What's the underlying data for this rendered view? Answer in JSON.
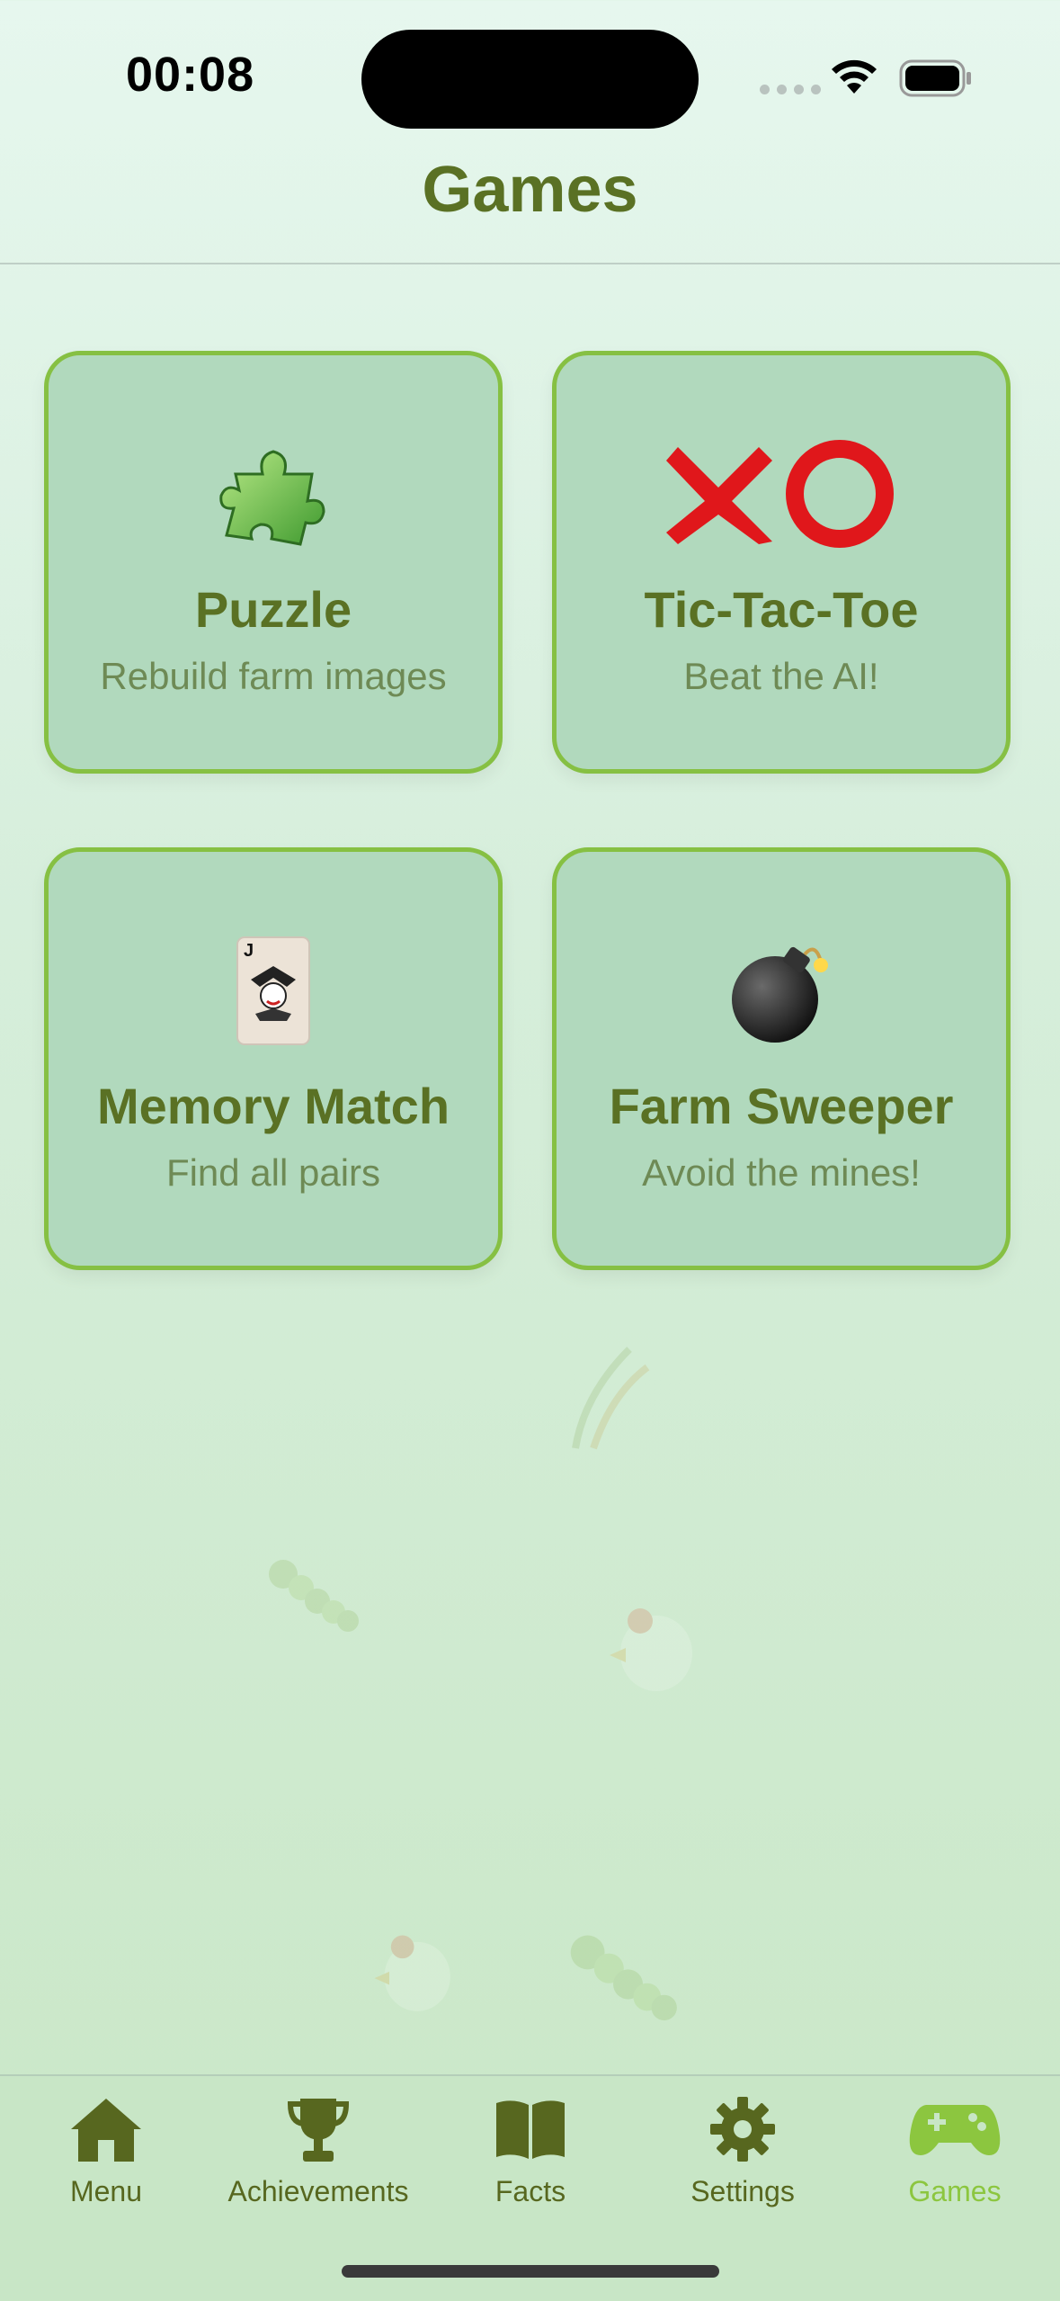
{
  "status_bar": {
    "time": "00:08"
  },
  "nav": {
    "title": "Games"
  },
  "games": [
    {
      "title": "Puzzle",
      "subtitle": "Rebuild farm images",
      "icon": "puzzle-piece-icon"
    },
    {
      "title": "Tic-Tac-Toe",
      "subtitle": "Beat the AI!",
      "icon": "x-o-icon"
    },
    {
      "title": "Memory Match",
      "subtitle": "Find all pairs",
      "icon": "joker-card-icon"
    },
    {
      "title": "Farm Sweeper",
      "subtitle": "Avoid the mines!",
      "icon": "bomb-icon"
    }
  ],
  "tabs": [
    {
      "label": "Menu",
      "icon": "house-icon",
      "active": false
    },
    {
      "label": "Achievements",
      "icon": "trophy-icon",
      "active": false
    },
    {
      "label": "Facts",
      "icon": "book-icon",
      "active": false
    },
    {
      "label": "Settings",
      "icon": "gear-icon",
      "active": false
    },
    {
      "label": "Games",
      "icon": "gamepad-icon",
      "active": true
    }
  ],
  "colors": {
    "primary_text": "#5a7124",
    "accent": "#8cc63f",
    "card_bg": "#b1d9bd",
    "card_border": "#86c043"
  }
}
